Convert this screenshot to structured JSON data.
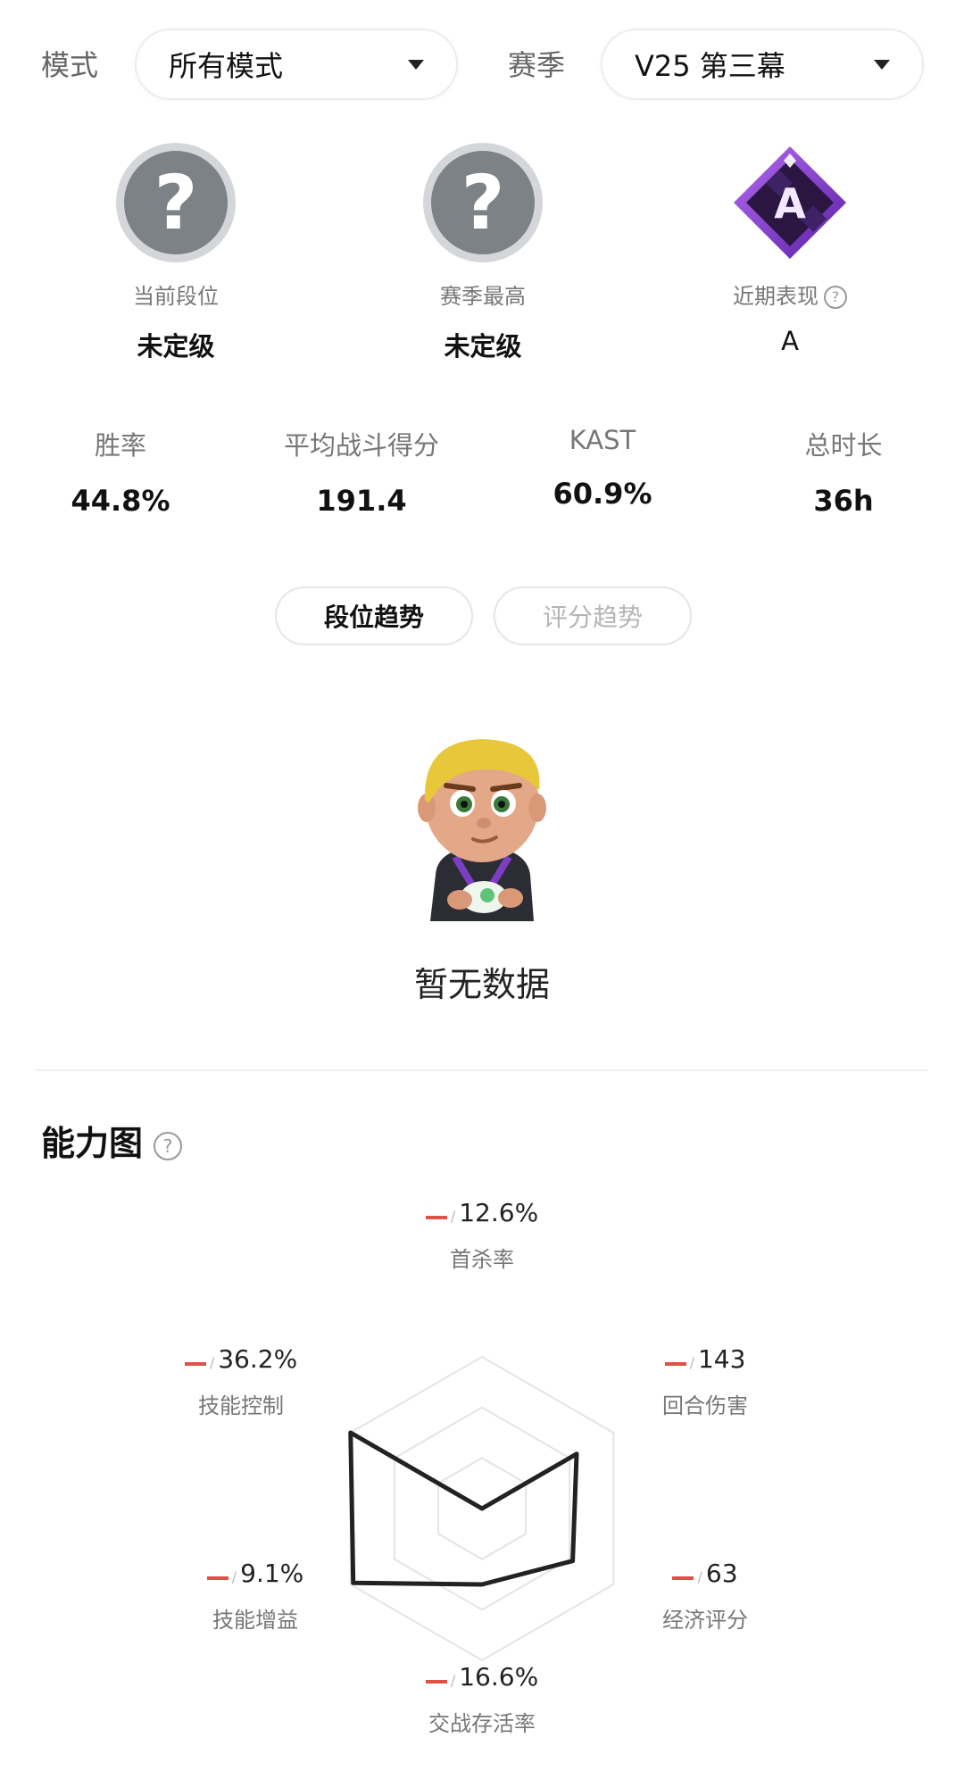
{
  "filters": {
    "mode_label": "模式",
    "mode_value": "所有模式",
    "season_label": "赛季",
    "season_value": "V25 第三幕"
  },
  "ranks": [
    {
      "badge": "?",
      "title": "当前段位",
      "value": "未定级"
    },
    {
      "badge": "?",
      "title": "赛季最高",
      "value": "未定级"
    },
    {
      "badge": "A",
      "title": "近期表现",
      "value": "A"
    }
  ],
  "stats": [
    {
      "label": "胜率",
      "value": "44.8%"
    },
    {
      "label": "平均战斗得分",
      "value": "191.4"
    },
    {
      "label": "KAST",
      "value": "60.9%"
    },
    {
      "label": "总时长",
      "value": "36h"
    }
  ],
  "trend_tabs": {
    "rank_trend": "段位趋势",
    "score_trend": "评分趋势"
  },
  "empty_state": {
    "text": "暂无数据"
  },
  "ability": {
    "title": "能力图",
    "items": [
      {
        "name": "首杀率",
        "value": "12.6%",
        "level": 0.0
      },
      {
        "name": "回合伤害",
        "value": "143",
        "level": 0.72
      },
      {
        "name": "经济评分",
        "value": "63",
        "level": 0.69
      },
      {
        "name": "交战存活率",
        "value": "16.6%",
        "level": 0.5
      },
      {
        "name": "技能增益",
        "value": "9.1%",
        "level": 0.98
      },
      {
        "name": "技能控制",
        "value": "36.2%",
        "level": 1.0
      }
    ]
  },
  "colors": {
    "accent_dash": "#e05046",
    "radar_line": "#222222",
    "badge_purple": "#8a3fd8"
  }
}
